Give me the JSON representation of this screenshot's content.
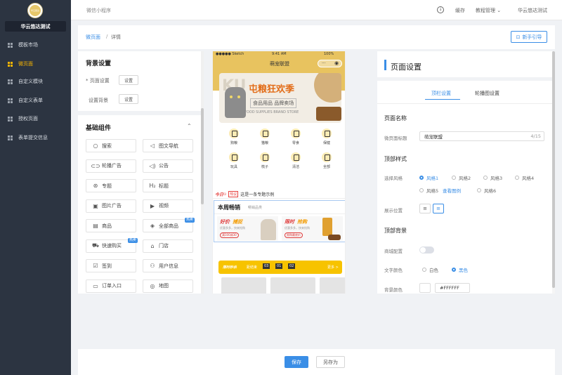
{
  "sidebar": {
    "logo_text": "华云悠达",
    "shop_name": "华云悠达测试",
    "items": [
      {
        "label": "模板市场",
        "active": false
      },
      {
        "label": "微页面",
        "active": true
      },
      {
        "label": "自定义模块",
        "active": false
      },
      {
        "label": "自定义表单",
        "active": false
      },
      {
        "label": "授权页面",
        "active": false
      },
      {
        "label": "表单提交信息",
        "active": false
      }
    ]
  },
  "topbar": {
    "title": "微信小程序",
    "cache": "缓存",
    "tutorial": "教程管理",
    "user": "华云悠达测试",
    "chevron": "⌄"
  },
  "breadcrumb": {
    "parent": "微页面",
    "sep": "/",
    "current": "详情",
    "guide": "新手引导"
  },
  "left_panel": {
    "bg_title": "背景设置",
    "page_setting_label": "* 页面设置",
    "page_bg_label": "设置背景",
    "set_btn": "设置",
    "basic_title": "基础组件",
    "components": [
      {
        "label": "搜索",
        "icon": "○"
      },
      {
        "label": "图文导航",
        "icon": "◁"
      },
      {
        "label": "轮播广告",
        "icon": "⊂⊃"
      },
      {
        "label": "公告",
        "icon": "◁)"
      },
      {
        "label": "专题",
        "icon": "⊛"
      },
      {
        "label": "标题",
        "icon": "H₂"
      },
      {
        "label": "图片广告",
        "icon": "▣"
      },
      {
        "label": "视频",
        "icon": "▶"
      },
      {
        "label": "商品",
        "icon": "▤"
      },
      {
        "label": "全部商品",
        "icon": "◈",
        "badge": "热卖"
      },
      {
        "label": "快速购买",
        "icon": "⛟",
        "badge": "热卖"
      },
      {
        "label": "门店",
        "icon": "⌂"
      },
      {
        "label": "签到",
        "icon": "☑"
      },
      {
        "label": "用户信息",
        "icon": "⚇"
      },
      {
        "label": "订单入口",
        "icon": "▭"
      },
      {
        "label": "地图",
        "icon": "◎"
      }
    ]
  },
  "phone": {
    "status_carrier": "●●●●● Sketch",
    "status_time": "9:41 AM",
    "status_battery": "100%",
    "nav_title": "萌宠联盟",
    "banner": {
      "watermark": "KU",
      "headline": "屯粮狂欢季",
      "sub": "食品用品 品牌卖场",
      "english": "FOOD SUPPLIES BRAND STORE"
    },
    "categories": [
      "狗粮",
      "猫粮",
      "零食",
      "保健",
      "玩具",
      "梳子",
      "清洁",
      "全部"
    ],
    "notice": {
      "today": "今日",
      "tag": "热议",
      "text": "这是一条专题示例"
    },
    "hot": {
      "title": "本周畅销",
      "subtitle": "畅销品类",
      "card1": {
        "title_a": "好价",
        "title_b": "捕捉",
        "desc": "优惠多多，快来抢购",
        "tag": "满100减30"
      },
      "card2": {
        "title_a": "限时",
        "title_b": "抢购",
        "desc": "优惠多多，快来抢购",
        "tag": "限购最底价"
      }
    },
    "flash": {
      "title": "限时秒杀",
      "sub": "距结束",
      "h": "03",
      "m": "01",
      "s": "02",
      "more": "更多 >"
    }
  },
  "right_panel": {
    "title": "页面设置",
    "tabs": [
      "顶栏设置",
      "轮播图设置"
    ],
    "page_name_h": "页面名称",
    "page_title_label": "微页面标题",
    "page_title_value": "萌宠联盟",
    "page_title_count": "4/15",
    "top_style_h": "顶部样式",
    "style_label": "选择风格",
    "styles": [
      "风格1",
      "风格2",
      "风格3",
      "风格4",
      "风格5",
      "风格6"
    ],
    "view_example": "查看图例",
    "position_label": "展示位置",
    "top_bg_h": "顶部背景",
    "store_label": "商城配置",
    "text_color_label": "文字颜色",
    "colors": [
      "白色",
      "黑色"
    ],
    "bg_color_label": "背景颜色",
    "bg_color_value": "#FFFFFF"
  },
  "footer": {
    "save": "保存",
    "save_as": "另存为"
  }
}
